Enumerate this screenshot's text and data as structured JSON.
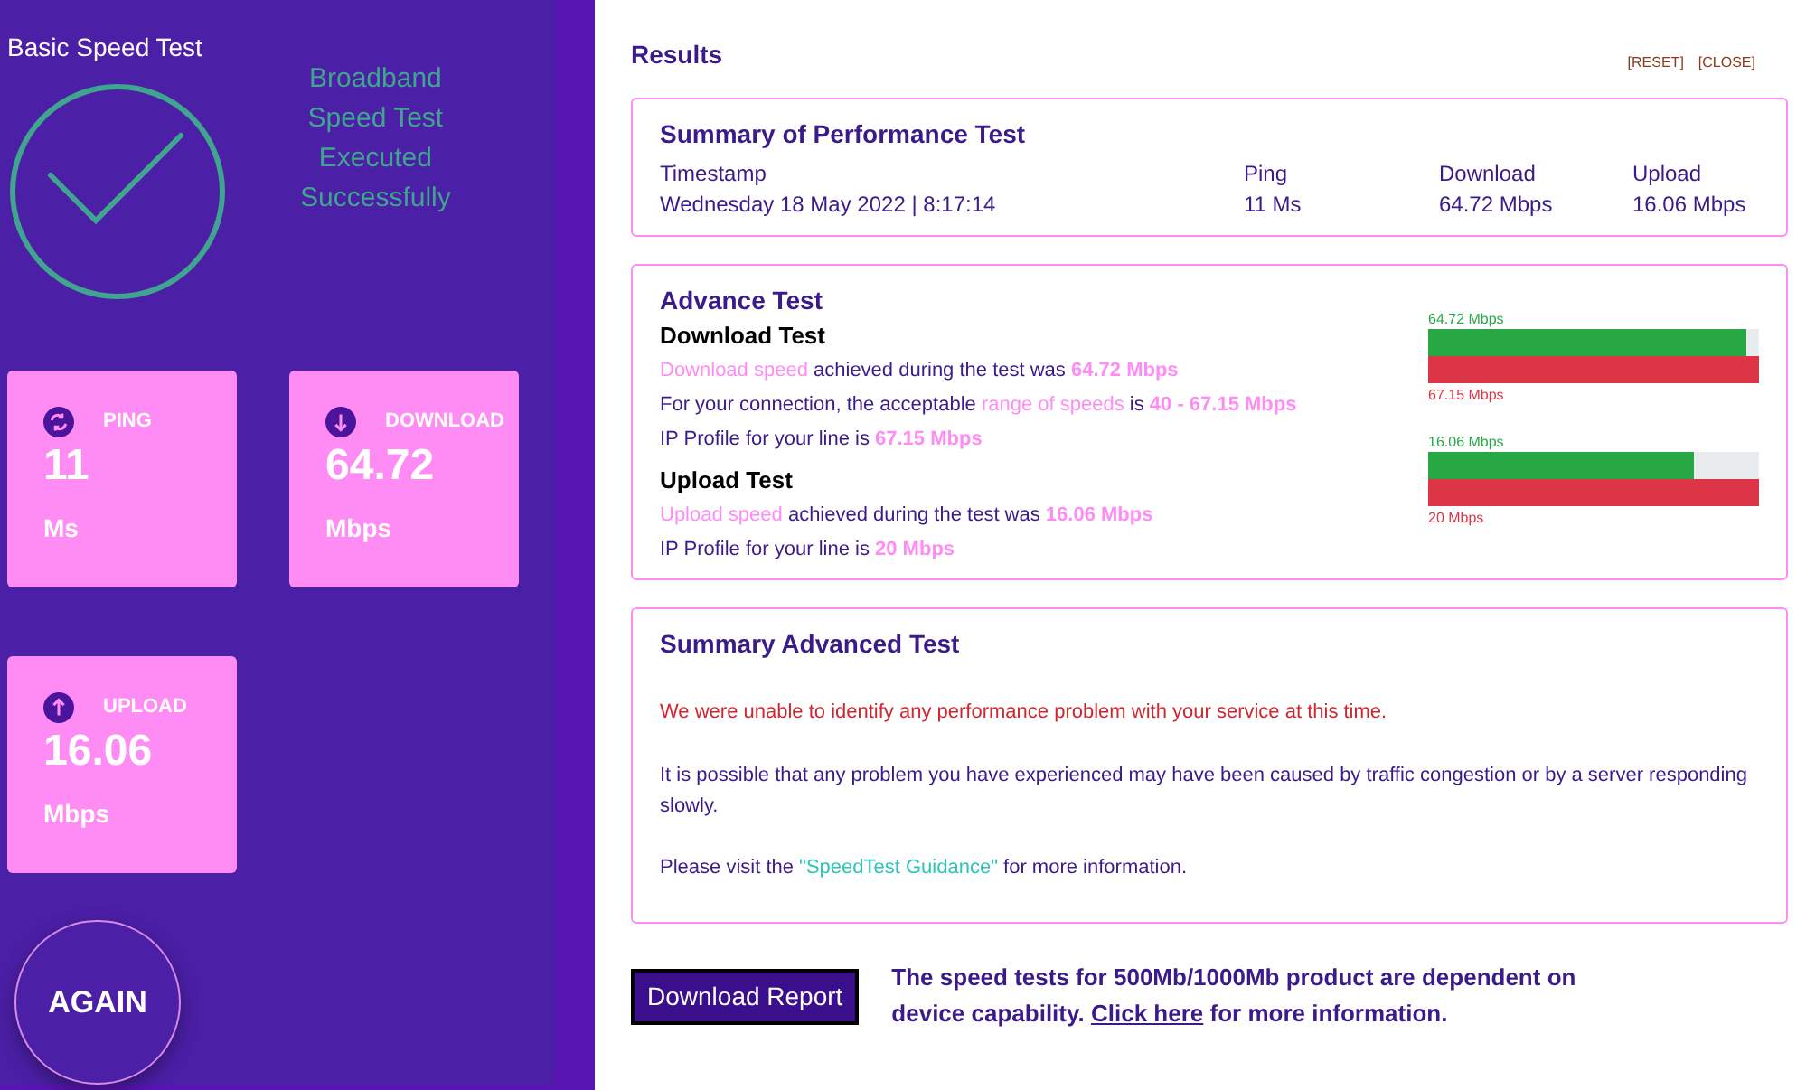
{
  "sidebar": {
    "title": "Basic Speed Test",
    "status_lines": [
      "Broadband",
      "Speed Test",
      "Executed",
      "Successfully"
    ],
    "stats": [
      {
        "kind": "ping",
        "label": "PING",
        "value": "11",
        "unit": "Ms"
      },
      {
        "kind": "download",
        "label": "DOWNLOAD",
        "value": "64.72",
        "unit": "Mbps"
      },
      {
        "kind": "upload",
        "label": "UPLOAD",
        "value": "16.06",
        "unit": "Mbps"
      }
    ],
    "again_button": "AGAIN"
  },
  "results": {
    "title": "Results",
    "actions": [
      "[RESET]",
      "[CLOSE]"
    ],
    "summary": {
      "title": "Summary of Performance Test",
      "columns": [
        {
          "label": "Timestamp",
          "value": "Wednesday 18 May 2022 | 8:17:14"
        },
        {
          "label": "Ping",
          "value": "11 Ms"
        },
        {
          "label": "Download",
          "value": "64.72 Mbps"
        },
        {
          "label": "Upload",
          "value": "16.06 Mbps"
        }
      ]
    },
    "advance": {
      "title": "Advance Test",
      "tests": [
        {
          "title": "Download Test",
          "lines": [
            [
              {
                "kind": "term",
                "text": "Download speed"
              },
              {
                "kind": "plain",
                "text": " achieved during the test was "
              },
              {
                "kind": "value",
                "text": "64.72 Mbps"
              }
            ],
            [
              {
                "kind": "plain",
                "text": "For your connection, the acceptable "
              },
              {
                "kind": "term",
                "text": "range of speeds"
              },
              {
                "kind": "plain",
                "text": " is "
              },
              {
                "kind": "value",
                "text": "40 - 67.15 Mbps"
              }
            ],
            [
              {
                "kind": "plain",
                "text": "IP Profile for your line is "
              },
              {
                "kind": "value",
                "text": "67.15 Mbps"
              }
            ]
          ],
          "bar": {
            "measured": "64.72 Mbps",
            "level": 0.964,
            "profile": "67.15 Mbps"
          }
        },
        {
          "title": "Upload Test",
          "lines": [
            [
              {
                "kind": "term",
                "text": "Upload speed"
              },
              {
                "kind": "plain",
                "text": " achieved during the test was "
              },
              {
                "kind": "value",
                "text": "16.06 Mbps"
              }
            ],
            [
              {
                "kind": "plain",
                "text": "IP Profile for your line is "
              },
              {
                "kind": "value",
                "text": "20 Mbps"
              }
            ]
          ],
          "bar": {
            "measured": "16.06 Mbps",
            "level": 0.803,
            "profile": "20 Mbps"
          }
        }
      ]
    },
    "summary_advanced": {
      "title": "Summary Advanced Test",
      "alert": "We were unable to identify any performance problem with your service at this time.",
      "note": "It is possible that any problem you have experienced may have been caused by traffic congestion or by a server responding slowly.",
      "guidance": {
        "before": "Please visit the ",
        "link": "\"SpeedTest Guidance\"",
        "after": " for more information."
      }
    },
    "footer": {
      "button": "Download Report",
      "notice": {
        "before": "The speed tests for 500Mb/1000Mb product are dependent on device capability. ",
        "link": "Click here",
        "after": " for more information."
      }
    }
  }
}
